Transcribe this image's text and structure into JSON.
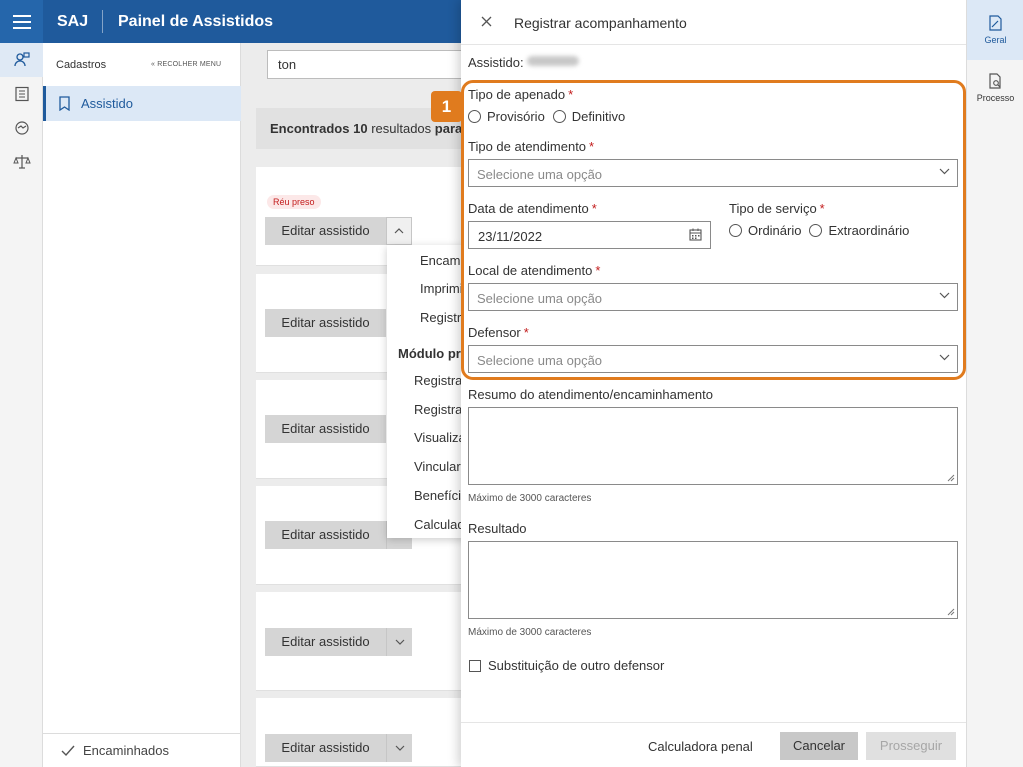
{
  "header": {
    "brand": "SAJ",
    "title": "Painel de Assistidos"
  },
  "rail": {
    "icons": [
      "users-icon",
      "list-icon",
      "handshake-icon",
      "scale-icon"
    ]
  },
  "sidebar": {
    "heading": "Cadastros",
    "collapse_label": "RECOLHER MENU",
    "active_item": "Assistido",
    "bottom_item": "Encaminhados"
  },
  "main": {
    "search_value": "ton",
    "results": {
      "prefix": "Encontrados",
      "count": "10",
      "suffix": "resultados",
      "cut": "para"
    },
    "badge": "Réu preso",
    "edit_label": "Editar assistido",
    "dropdown": {
      "items_top": [
        "Encaminhar",
        "Imprimir",
        "Registrar"
      ],
      "section": "Módulo prisional",
      "items_bottom": [
        "Registrar",
        "Registrar",
        "Visualizar",
        "Vincular",
        "Benefícios",
        "Calculadora"
      ]
    }
  },
  "panel": {
    "title": "Registrar acompanhamento",
    "assistido_label": "Assistido:",
    "tipo_apenado": {
      "label": "Tipo de apenado",
      "options": [
        "Provisório",
        "Definitivo"
      ]
    },
    "tipo_atendimento": {
      "label": "Tipo de atendimento",
      "placeholder": "Selecione uma opção"
    },
    "data_atendimento": {
      "label": "Data de atendimento",
      "value": "23/11/2022"
    },
    "tipo_servico": {
      "label": "Tipo de serviço",
      "options": [
        "Ordinário",
        "Extraordinário"
      ]
    },
    "local_atendimento": {
      "label": "Local de atendimento",
      "placeholder": "Selecione uma opção"
    },
    "defensor": {
      "label": "Defensor",
      "placeholder": "Selecione uma opção"
    },
    "resumo": {
      "label": "Resumo do atendimento/encaminhamento",
      "hint": "Máximo de 3000 caracteres"
    },
    "resultado": {
      "label": "Resultado",
      "hint": "Máximo de 3000 caracteres"
    },
    "substituicao": "Substituição de outro defensor",
    "buttons": {
      "calc": "Calculadora penal",
      "cancel": "Cancelar",
      "next": "Prosseguir"
    },
    "step_number": "1"
  },
  "right_rail": {
    "items": [
      "Geral",
      "Processo"
    ]
  },
  "colors": {
    "primary": "#1f5a9c",
    "highlight": "#e07b1e",
    "required": "#c21b1b"
  }
}
